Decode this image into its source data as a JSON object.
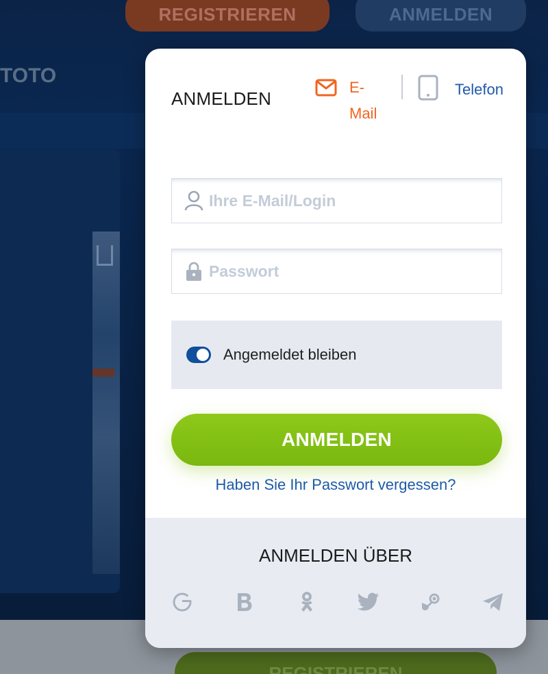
{
  "background": {
    "register_label": "REGISTRIEREN",
    "login_label": "ANMELDEN",
    "toto_label": "TOTO",
    "footer_button_label": "REGISTRIEREN"
  },
  "modal": {
    "title": "ANMELDEN",
    "tabs": {
      "email": {
        "label": "E-Mail",
        "icon": "envelope-icon",
        "color": "#f0651f"
      },
      "phone": {
        "label": "Telefon",
        "icon": "phone-icon",
        "color": "#1e5aa8"
      }
    },
    "login_field": {
      "placeholder": "Ihre E-Mail/Login",
      "value": "",
      "icon": "user-icon"
    },
    "password_field": {
      "placeholder": "Passwort",
      "value": "",
      "icon": "lock-icon"
    },
    "remember": {
      "label": "Angemeldet bleiben",
      "checked": true
    },
    "submit_label": "ANMELDEN",
    "forgot_label": "Haben Sie Ihr Passwort vergessen?",
    "social": {
      "title": "ANMELDEN ÜBER",
      "providers": [
        "google-icon",
        "b-icon",
        "odnoklassniki-icon",
        "twitter-icon",
        "steam-icon",
        "telegram-icon"
      ]
    }
  },
  "colors": {
    "accent_green": "#7fbf12",
    "link_blue": "#1e5aa8",
    "email_orange": "#f0651f",
    "toggle_blue": "#0f4f9c"
  }
}
